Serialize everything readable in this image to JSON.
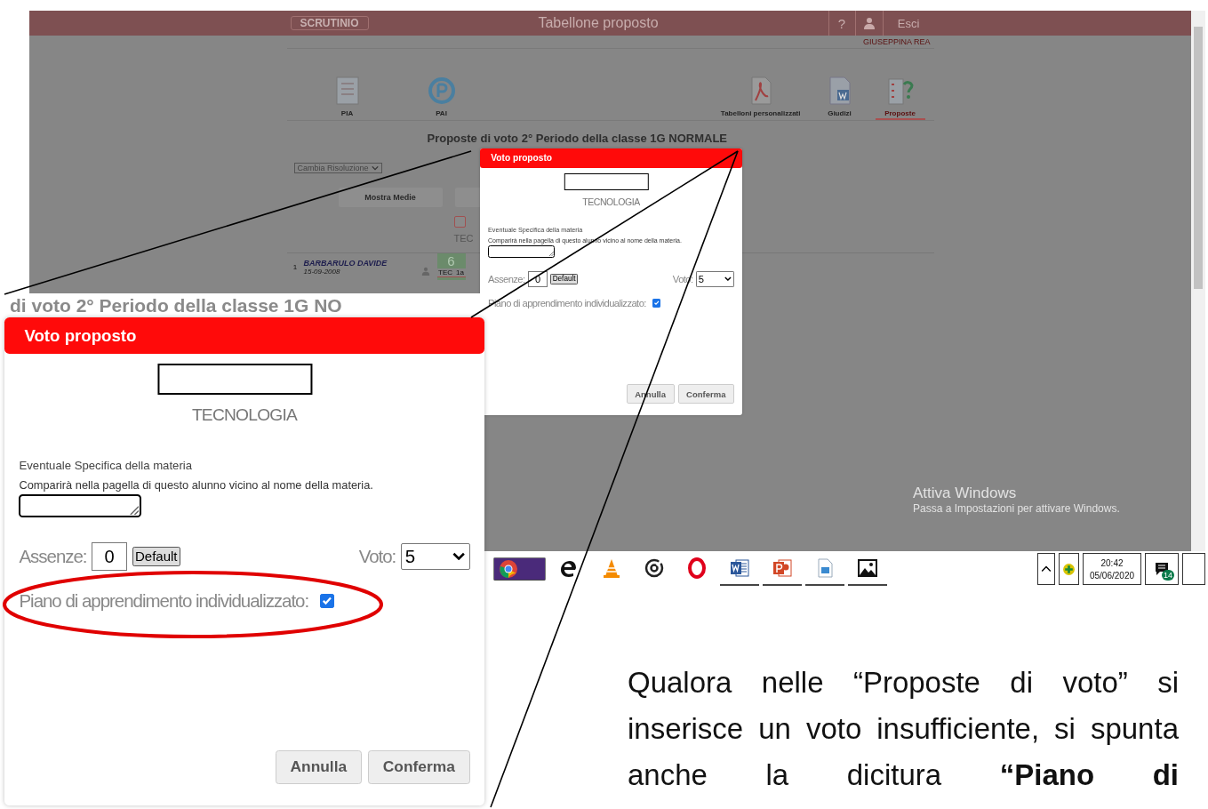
{
  "screenshot": {
    "app_header": {
      "logo": "SCRUTINIO",
      "title": "Tabellone proposto",
      "help": "?",
      "logout": "Esci"
    },
    "user_name": "GIUSEPPINA REA",
    "toolbar": [
      {
        "label": "PIA",
        "kind": "list",
        "selected": false
      },
      {
        "label": "PAI",
        "kind": "p-cycle",
        "selected": false
      },
      {
        "label": "Tabelloni personalizzati",
        "kind": "pdf",
        "selected": false
      },
      {
        "label": "Giudizi",
        "kind": "word",
        "selected": false
      },
      {
        "label": "Proposte",
        "kind": "numbers",
        "selected": true
      }
    ],
    "heading": "Proposte di voto **2° Periodo** della classe **1G NORMALE**",
    "resolution_select": "Cambia Risoluzione",
    "buttons": [
      "Mostra Medie"
    ],
    "column": {
      "label": "TEC",
      "checked": false
    },
    "student_row": {
      "number": "1",
      "name": "BARBARULO DAVIDE",
      "birth_date": "15-09-2008",
      "grade": "6",
      "grade_subject": "TEC",
      "grade_period": "1a"
    },
    "dialog": {
      "title": "Voto proposto",
      "subject": "TECNOLOGIA",
      "specifica_label": "Eventuale Specifica della materia",
      "specifica_hint": "Comparirà nella pagella di questo alunno vicino al nome della materia.",
      "assenze_label": "Assenze:",
      "assenze_value": "0",
      "default_button": "Default",
      "voto_label": "Voto:",
      "voto_value": "5",
      "piano_label": "Piano di apprendimento individualizzato:",
      "piano_checked": true,
      "cancel": "Annulla",
      "confirm": "Conferma"
    },
    "activation": {
      "title": "Attiva Windows",
      "text": "Passa a Impostazioni per attivare Windows."
    },
    "taskbar": {
      "apps": [
        {
          "kind": "chrome",
          "selected": true,
          "running": true
        },
        {
          "kind": "edge",
          "selected": false,
          "running": false
        },
        {
          "kind": "vlc",
          "selected": false,
          "running": false
        },
        {
          "kind": "groove",
          "selected": false,
          "running": false
        },
        {
          "kind": "opera",
          "selected": false,
          "running": false
        },
        {
          "kind": "word",
          "selected": false,
          "running": true
        },
        {
          "kind": "powerpoint",
          "selected": false,
          "running": true
        },
        {
          "kind": "photo-file",
          "selected": false,
          "running": true
        },
        {
          "kind": "picture",
          "selected": false,
          "running": true
        }
      ],
      "time": "20:42",
      "date": "05/06/2020",
      "notifications": "14"
    }
  },
  "zoomed_dialog": {
    "heading_fragment": "di voto **2° Periodo** della classe **1G NO**",
    "dialog": {
      "title": "Voto proposto",
      "subject": "TECNOLOGIA",
      "specifica_label": "Eventuale Specifica della materia",
      "specifica_hint": "Comparirà nella pagella di questo alunno vicino al nome della materia.",
      "assenze_label": "Assenze:",
      "assenze_value": "0",
      "default_button": "Default",
      "voto_label": "Voto:",
      "voto_value": "5",
      "piano_label": "Piano di apprendimento individualizzato:",
      "piano_checked": true,
      "cancel": "Annulla",
      "confirm": "Conferma"
    }
  },
  "paragraph": "Qualora nelle “Proposte di voto” si inserisce un voto insufficiente, si spunta anche la dicitura **“Piano di**"
}
